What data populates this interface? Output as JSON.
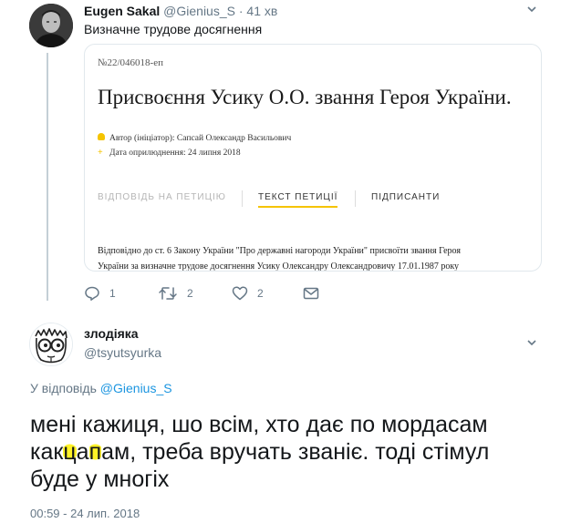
{
  "tweet1": {
    "author_name": "Eugen Sakal",
    "handle": "@Gienius_S",
    "separator": "·",
    "time_ago": "41 хв",
    "text": "Визначне трудове досягнення",
    "card": {
      "petition_number": "№22/046018-еп",
      "title": "Присвоєння Усику О.О. звання Героя України.",
      "author_line": "Автор (ініціатор): Сапсай Олександр Васильович",
      "date_line": "Дата оприлюднення: 24 липня 2018",
      "tabs": [
        {
          "label": "ВІДПОВІДЬ НА ПЕТИЦІЮ",
          "state": "inactive"
        },
        {
          "label": "ТЕКСТ ПЕТИЦІЇ",
          "state": "active"
        },
        {
          "label": "ПІДПИСАНТИ",
          "state": "normal"
        }
      ],
      "body_line1": "Відповідно до ст. 6 Закону України \"Про державні нагороди України\" присвоїти звання Героя",
      "body_line2": "України за визначне трудове досягнення Усику Олександру Олександровичу 17.01.1987 року",
      "accent_color": "#f5c400"
    },
    "actions": {
      "reply_count": "1",
      "retweet_count": "2",
      "like_count": "2"
    }
  },
  "tweet2": {
    "author_name": "злодіяка",
    "handle": "@tsyutsyurka",
    "reply_prefix": "У відповідь",
    "reply_to": "@Gienius_S",
    "text_line1": "мені кажиця, шо всім, хто дає по мордасам",
    "text_line2_a": "как",
    "text_line2_b": "ц",
    "text_line2_c": "а",
    "text_line2_d": "п",
    "text_line2_e": "ам, треба вручать званіє. тоді стімул",
    "text_line3": "буде у многіх",
    "timestamp": "00:59 - 24 лип. 2018"
  },
  "colors": {
    "link": "#1b95e0",
    "secondary_text": "#657786",
    "highlight": "#fff000"
  },
  "icons": {
    "caret": "chevron-down-icon",
    "reply": "reply-icon",
    "retweet": "retweet-icon",
    "like": "heart-icon",
    "dm": "envelope-icon"
  }
}
